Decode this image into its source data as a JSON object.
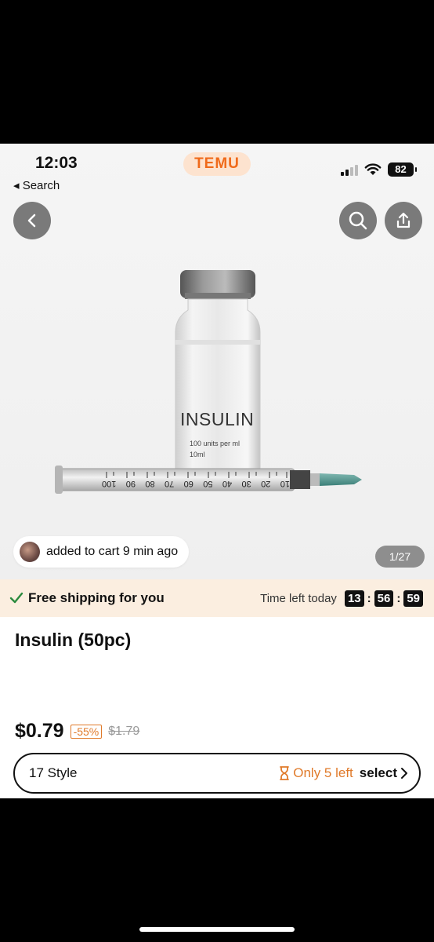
{
  "status_bar": {
    "time": "12:03",
    "back_app": "◂ Search",
    "battery": "82"
  },
  "header": {
    "brand": "TEMU"
  },
  "product_image": {
    "vial_label": "INSULIN",
    "vial_sub1": "100 units per ml",
    "vial_sub2": "10ml",
    "syringe_marks": [
      "100",
      "90",
      "80",
      "70",
      "60",
      "50",
      "40",
      "30",
      "20",
      "10"
    ]
  },
  "social_proof": {
    "text": "added to cart 9 min ago"
  },
  "gallery": {
    "counter": "1/27"
  },
  "shipping": {
    "text": "Free shipping for you",
    "timer_label": "Time left today",
    "hours": "13",
    "minutes": "56",
    "seconds": "59"
  },
  "product": {
    "title": "Insulin (50pc)",
    "price": "$0.79",
    "discount": "-55%",
    "original_price": "$1.79"
  },
  "style_selector": {
    "count_label": "17 Style",
    "stock": "Only 5 left",
    "select_label": "select"
  },
  "colors": {
    "accent": "#f06a1a",
    "warning": "#e07a2a",
    "ship_bg": "#fbeee0"
  }
}
